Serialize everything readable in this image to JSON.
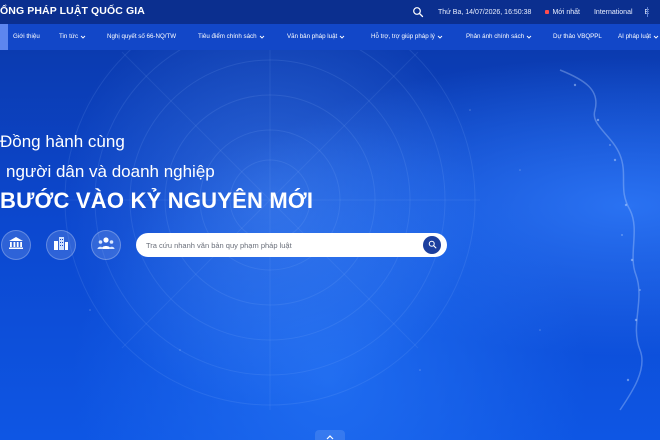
{
  "header": {
    "site_title": "ỔNG PHÁP LUẬT QUỐC GIA",
    "datetime": "Thứ Ba, 14/07/2026, 16:50:38",
    "hot_label": "Mới nhất",
    "international_label": "International",
    "lang_short": "E"
  },
  "nav": {
    "items": [
      {
        "label": "Giới thiệu",
        "has_dropdown": false
      },
      {
        "label": "Tin tức",
        "has_dropdown": true
      },
      {
        "label": "Nghị quyết số 66-NQ/TW",
        "has_dropdown": false
      },
      {
        "label": "Tiêu điểm chính sách",
        "has_dropdown": true
      },
      {
        "label": "Văn bản pháp luật",
        "has_dropdown": true
      },
      {
        "label": "Hỗ trợ, trợ giúp pháp lý",
        "has_dropdown": true
      },
      {
        "label": "Phản ánh chính sách",
        "has_dropdown": true
      },
      {
        "label": "Dự thảo VBQPPL",
        "has_dropdown": false
      },
      {
        "label": "AI pháp luật",
        "has_dropdown": true
      }
    ]
  },
  "hero": {
    "line1": "Đồng hành cùng",
    "line2": "người dân và doanh nghiệp",
    "line3": "BƯỚC VÀO KỶ NGUYÊN MỚI",
    "search_placeholder": "Tra cứu nhanh văn bản quy phạm pháp luật",
    "quick_icons": [
      "government-building-icon",
      "city-buildings-icon",
      "people-group-icon"
    ]
  },
  "colors": {
    "topbar": "#0b2f8f",
    "navbar": "#1247c8",
    "hero_blue": "#0c48cf",
    "search_button": "#1c3f9e"
  }
}
